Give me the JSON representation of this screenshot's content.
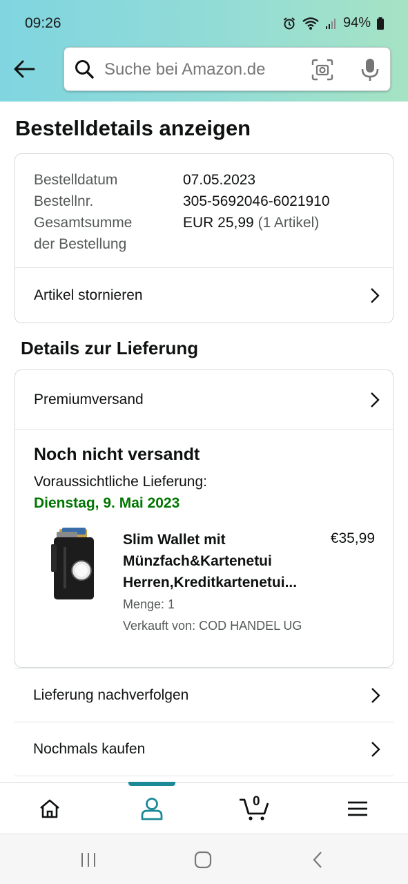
{
  "status_bar": {
    "time": "09:26",
    "battery": "94%"
  },
  "search": {
    "placeholder": "Suche bei Amazon.de"
  },
  "page": {
    "title": "Bestelldetails anzeigen"
  },
  "order": {
    "rows": [
      {
        "label": "Bestelldatum",
        "value": "07.05.2023",
        "extra": ""
      },
      {
        "label": "Bestellnr.",
        "value": "305-5692046-6021910",
        "extra": ""
      },
      {
        "label": "Gesamtsumme",
        "value": "EUR 25,99",
        "extra": "(1 Artikel)"
      },
      {
        "label": "der Bestellung",
        "value": "",
        "extra": ""
      }
    ],
    "cancel_label": "Artikel stornieren"
  },
  "delivery": {
    "section_title": "Details zur Lieferung",
    "shipping_method": "Premiumversand",
    "status": "Noch nicht versandt",
    "eta_label": "Voraussichtliche Lieferung:",
    "eta_date": "Dienstag, 9. Mai 2023",
    "product": {
      "title": "Slim Wallet mit Münzfach&Kartenetui Herren,Kreditkartenetui...",
      "price": "€35,99",
      "quantity": "Menge: 1",
      "seller": "Verkauft von: COD HANDEL UG"
    }
  },
  "actions": {
    "track": "Lieferung nachverfolgen",
    "buy_again": "Nochmals kaufen"
  },
  "bottom_nav": {
    "active": "account",
    "cart_count": "0"
  },
  "colors": {
    "accent": "#1b8a96",
    "delivery_green": "#007600",
    "gradient_start": "#80d5e0",
    "gradient_end": "#a6e3c4"
  }
}
